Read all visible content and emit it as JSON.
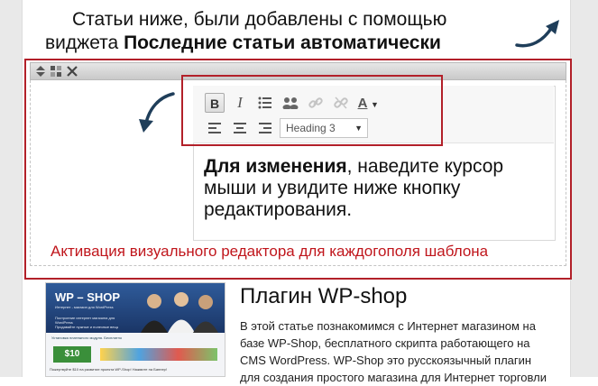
{
  "heading": {
    "line1": "Статьи ниже, были добавлены с помощью",
    "line2_prefix": "виджета ",
    "line2_bold": "Последние статьи автоматически"
  },
  "widget_controls": {
    "move_icon": "move-icon",
    "toggle_icon": "grid-toggle-icon",
    "close_icon": "close-icon"
  },
  "toolbar": {
    "bold": "B",
    "italic": "I",
    "text_color": "A",
    "format_select": "Heading 3"
  },
  "editor": {
    "bold_text": "Для изменения",
    "text": ", наведите курсор мыши и увидите ниже кнопку редактирования."
  },
  "caption": "Активация визуального редактора для каждогополя шаблона",
  "thumbnail": {
    "logo_prefix": "WP",
    "logo_suffix": "SHOP",
    "tagline1": "Интернет - магазин для WordPress",
    "tagline2": "Построение интернет магазина для WordPress",
    "tagline3": "Продавайте нужные и полезные вещи",
    "promo": "Установка платежного модуля. Бесплатно",
    "banner": "Пожертвуйте $10 на развитие проекта WP-Shop! Нажмите на Баннер!",
    "donate": "$10"
  },
  "article": {
    "title": "Плагин WP-shop",
    "body": "В этой статье познакомимся с Интернет магазином на базе WP-Shop, бесплатного скрипта работающего на CMS WordPress. WP-Shop это русскоязычный плагин для создания простого магазина для Интернет торговли"
  },
  "colors": {
    "highlight": "#b22029",
    "caption": "#c0161c",
    "arrow": "#1f3e5a"
  }
}
